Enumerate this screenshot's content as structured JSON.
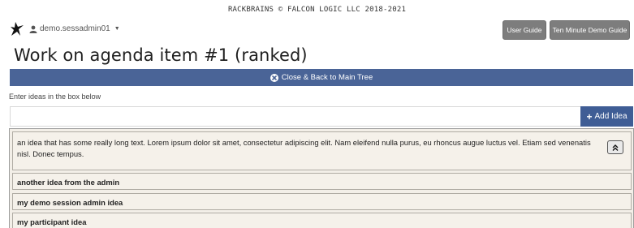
{
  "copyright": "RACKBRAINS © FALCON LOGIC LLC 2018-2021",
  "header": {
    "logo_icon": "bird-logo-icon",
    "user_icon": "user-icon",
    "username": "demo.sessadmin01",
    "user_caret_icon": "caret-down-icon",
    "user_guide_label": "User Guide",
    "demo_guide_label": "Ten Minute Demo Guide"
  },
  "page_title": "Work on agenda item #1 (ranked)",
  "close_bar": {
    "icon": "close-circle-icon",
    "label": "Close & Back to Main Tree"
  },
  "idea_entry": {
    "label": "Enter ideas in the box below",
    "value": "",
    "add_label": "Add Idea",
    "add_icon": "plus-icon"
  },
  "ideas": [
    {
      "text": "an idea that has some really long text. Lorem ipsum dolor sit amet, consectetur adipiscing elit. Nam eleifend nulla purus, eu rhoncus augue luctus vel. Etiam sed venenatis nisl. Donec tempus.",
      "expanded": true
    },
    {
      "text": "another idea from the admin"
    },
    {
      "text": "my demo session admin idea"
    },
    {
      "text": "my participant idea"
    }
  ],
  "colors": {
    "close_bar": "#4a6497",
    "add_button": "#3f5d95",
    "header_buttons": "#7d7d7d",
    "idea_background": "#f5f1ea"
  }
}
